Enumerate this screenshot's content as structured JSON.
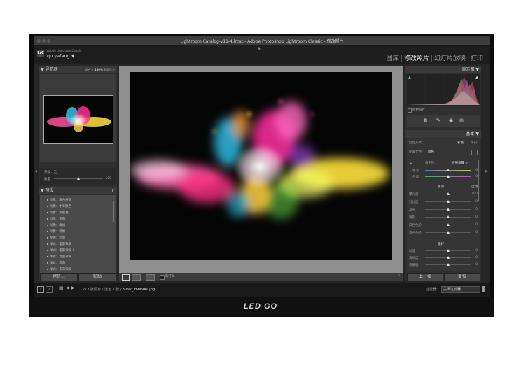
{
  "window_title": "Lightroom Catalog-v11-4.lrcat - Adobe Photoshop Lightroom Classic - 修改照片",
  "identity": {
    "app": "Adobe Lightroom Classic",
    "user": "qu yafang ▼",
    "badge": "LrC"
  },
  "modules": [
    "图库",
    "修改照片",
    "幻灯片放映",
    "打印"
  ],
  "navigator": {
    "title": "▼ 导航器",
    "zoom_options": [
      "适合 ÷",
      "100%",
      "300% ÷"
    ]
  },
  "snapshot": {
    "label": "预设：无",
    "amount_label": "数量",
    "amount_value": "100"
  },
  "presets": {
    "title": "▼ 预设",
    "add": "+",
    "items": [
      "▸ 肖像：深色皮肤",
      "▸ 肖像：中等肤色",
      "▸ 肖像：浅肤色",
      "▸ 肖像：黑白",
      "▸ 肖像：群组",
      "▸ 肖像：新娘",
      "▸ 视频：创意",
      "▸ 样式：电影效果",
      "▸ 样式：电影效果 II",
      "▸ 样式：复古效果",
      "▸ 样式：黑白",
      "▸ 样式：未来效果"
    ]
  },
  "left_buttons": {
    "copy": "拷贝...",
    "paste": "粘贴"
  },
  "histogram": {
    "title": "直方图 ▼",
    "original_label": "原始照片"
  },
  "basic": {
    "title": "基本 ▼",
    "treatment_label": "处理方式：",
    "treatment_color": "彩色",
    "treatment_bw": "黑白",
    "profile_label": "配置文件：",
    "profile_value": "颜色",
    "wb_label": "白平衡：",
    "wb_value": "原照设置 ÷",
    "wb_sliders": [
      {
        "label": "色温",
        "value": "0"
      },
      {
        "label": "色调",
        "value": "0"
      }
    ],
    "tone_label": "色调",
    "tone_auto": "自动",
    "tone_sliders": [
      {
        "label": "曝光度",
        "value": "0.00",
        "level": 0.5
      },
      {
        "label": "对比度",
        "value": "0",
        "level": 0.5
      },
      {
        "label": "高光",
        "value": "0",
        "level": 0.5
      },
      {
        "label": "阴影",
        "value": "0",
        "level": 0.5
      },
      {
        "label": "白色色阶",
        "value": "0",
        "level": 0.5
      },
      {
        "label": "黑色色阶",
        "value": "0",
        "level": 0.5
      }
    ],
    "presence_label": "偏好",
    "presence_sliders": [
      {
        "label": "纹理",
        "value": "0",
        "level": 0.5
      },
      {
        "label": "清晰度",
        "value": "0",
        "level": 0.5
      },
      {
        "label": "去朦胧",
        "value": "0",
        "level": 0.5
      }
    ]
  },
  "right_buttons": {
    "previous": "上一张",
    "reset": "复位"
  },
  "toolbar": {
    "soft_proof": "软打样"
  },
  "filmstrip": {
    "page1": "1",
    "page2": "2",
    "info": "213 张照片 / 选定 1 张 / ",
    "filename": "5292_imbr9Au.jpg",
    "filter_label": "过滤器：",
    "filter_value": "关闭过滤器"
  },
  "bezel_logo": "LED GO",
  "colors": {
    "panel": "#2f2f2f",
    "header": "#3a3a3a",
    "background": "#262626",
    "canvas": "#8f8f8f"
  }
}
